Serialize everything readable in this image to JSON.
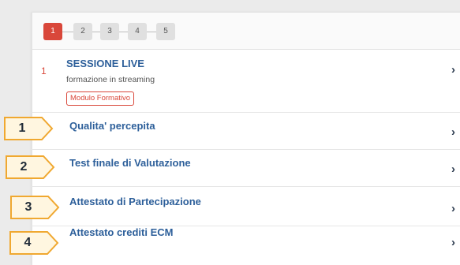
{
  "pager": {
    "pages": [
      "1",
      "2",
      "3",
      "4",
      "5"
    ],
    "active": "1"
  },
  "session": {
    "number": "1",
    "title": "SESSIONE LIVE",
    "subtitle": "formazione in streaming",
    "badge": "Modulo Formativo"
  },
  "items": [
    {
      "title": "Qualita' percepita",
      "callout": "1"
    },
    {
      "title": "Test finale di Valutazione",
      "callout": "2"
    },
    {
      "title": "Attestato di Partecipazione",
      "callout": "3"
    },
    {
      "title": "Attestato crediti ECM",
      "callout": "4"
    }
  ],
  "chevron": "›",
  "colors": {
    "accent": "#d9473a",
    "link": "#2d5f9a",
    "callout_border": "#f0a830",
    "callout_fill": "#fff6e0"
  },
  "icons": [
    "chevron-right-icon"
  ]
}
